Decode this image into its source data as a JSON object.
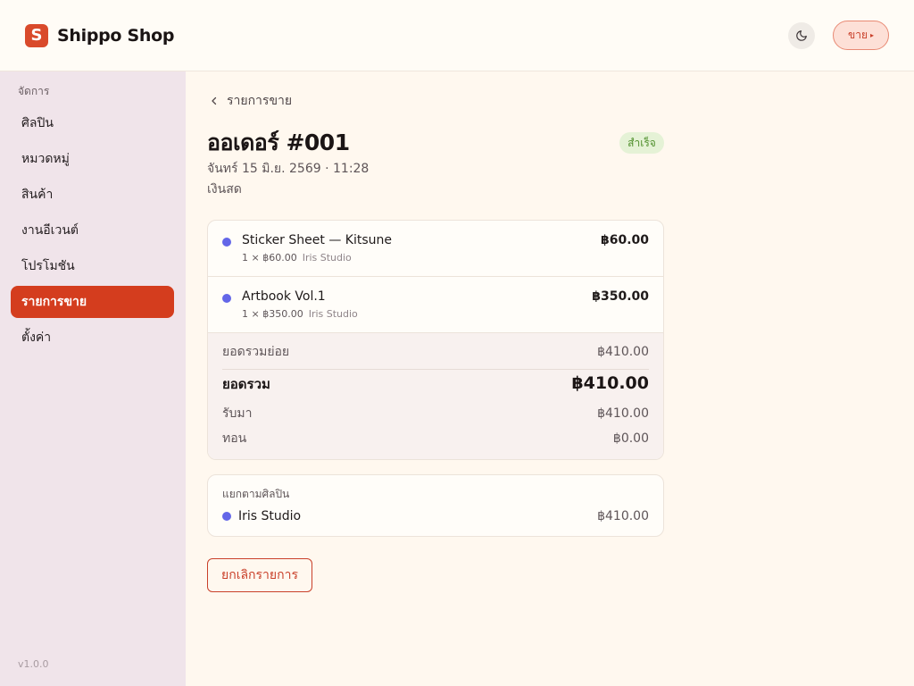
{
  "header": {
    "logo_letter": "S",
    "brand": "Shippo Shop",
    "sell_label": "ขาย",
    "sell_icon": "▸"
  },
  "sidebar": {
    "heading": "จัดการ",
    "items": [
      {
        "label": "ศิลปิน",
        "active": false
      },
      {
        "label": "หมวดหมู่",
        "active": false
      },
      {
        "label": "สินค้า",
        "active": false
      },
      {
        "label": "งานอีเวนต์",
        "active": false
      },
      {
        "label": "โปรโมชัน",
        "active": false
      },
      {
        "label": "รายการขาย",
        "active": true
      },
      {
        "label": "ตั้งค่า",
        "active": false
      }
    ],
    "version": "v1.0.0"
  },
  "main": {
    "back_label": "รายการขาย",
    "order_title": "ออเดอร์ #001",
    "status": "สำเร็จ",
    "date": "จันทร์ 15 มิ.ย. 2569 · 11:28",
    "payment_method": "เงินสด",
    "items": [
      {
        "name": "Sticker Sheet — Kitsune",
        "qty_price": "1 × ฿60.00",
        "artist": "Iris Studio",
        "price": "฿60.00"
      },
      {
        "name": "Artbook Vol.1",
        "qty_price": "1 × ฿350.00",
        "artist": "Iris Studio",
        "price": "฿350.00"
      }
    ],
    "summary": {
      "subtotal_label": "ยอดรวมย่อย",
      "subtotal": "฿410.00",
      "total_label": "ยอดรวม",
      "total": "฿410.00",
      "received_label": "รับมา",
      "received": "฿410.00",
      "change_label": "ทอน",
      "change": "฿0.00"
    },
    "by_artist": {
      "heading": "แยกตามศิลปิน",
      "rows": [
        {
          "name": "Iris Studio",
          "total": "฿410.00"
        }
      ]
    },
    "cancel_label": "ยกเลิกรายการ"
  },
  "colors": {
    "accent": "#d43d1e",
    "artist_dot": "#6366e8",
    "success_bg": "#e5f2d6",
    "success_text": "#4f8f2c"
  },
  "icons": {
    "theme": "moon-icon",
    "back": "chevron-left-icon"
  }
}
